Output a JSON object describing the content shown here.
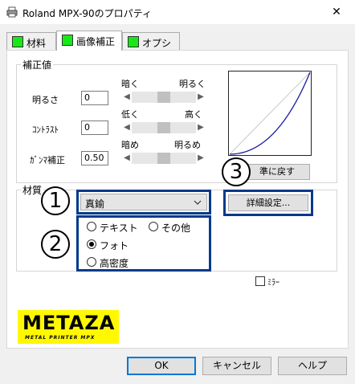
{
  "window": {
    "title": "Roland MPX-90のプロパティ",
    "close_glyph": "✕"
  },
  "tabs": [
    {
      "label": "材料",
      "active": false
    },
    {
      "label": "画像補正",
      "active": true
    },
    {
      "label": "オプション",
      "active": false
    }
  ],
  "correction": {
    "group_label": "補正値",
    "brightness": {
      "label": "明るさ",
      "value": "0",
      "left": "暗く",
      "right": "明るく",
      "level": 0.5
    },
    "contrast": {
      "label": "ｺﾝﾄﾗｽﾄ",
      "value": "0",
      "left": "低く",
      "right": "高く",
      "level": 0.5
    },
    "gamma": {
      "label": "ｶﾞﾝﾏ補正",
      "value": "0.50",
      "left": "暗め",
      "right": "明るめ",
      "level": 0.5
    },
    "reset_button": "準に戻す"
  },
  "material": {
    "group_label": "材質",
    "select_value": "真鍮",
    "detail_button": "詳細設定...",
    "radios": [
      {
        "label": "テキスト",
        "selected": false
      },
      {
        "label": "その他",
        "selected": false
      },
      {
        "label": "フォト",
        "selected": true
      },
      {
        "label": "高密度",
        "selected": false
      }
    ]
  },
  "mirror": {
    "label": "ﾐﾗｰ",
    "checked": false
  },
  "callouts": [
    "1",
    "2",
    "3"
  ],
  "logo": {
    "text": "METAZA",
    "subtext": "METAL PRINTER MPX"
  },
  "buttons": {
    "ok": "OK",
    "cancel": "キャンセル",
    "help": "ヘルプ"
  },
  "colors": {
    "accent": "#0078d7",
    "callout": "#003a8c",
    "curve": "#1a1aa6",
    "tab_indicator": "#17e817",
    "logo_bg": "#fff800"
  }
}
